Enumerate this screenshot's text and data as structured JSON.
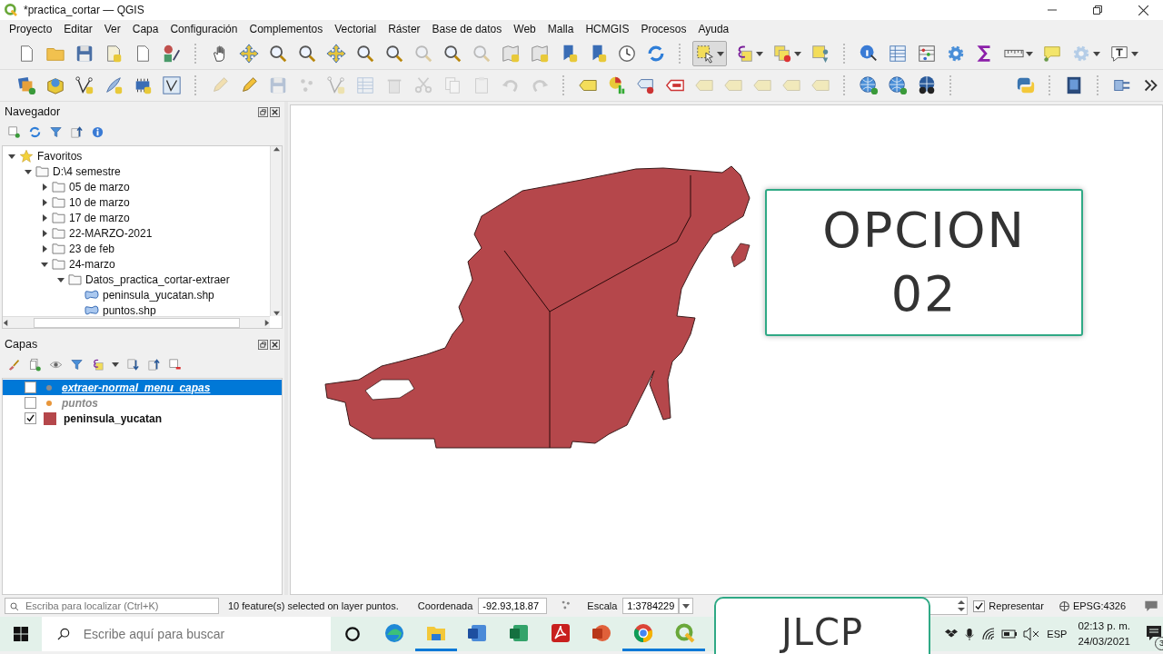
{
  "window": {
    "title": "*practica_cortar — QGIS"
  },
  "menu": [
    "Proyecto",
    "Editar",
    "Ver",
    "Capa",
    "Configuración",
    "Complementos",
    "Vectorial",
    "Ráster",
    "Base de datos",
    "Web",
    "Malla",
    "HCMGIS",
    "Procesos",
    "Ayuda"
  ],
  "navigator": {
    "title": "Navegador",
    "tree": [
      {
        "label": "Favoritos",
        "kind": "favorites",
        "expanded": true,
        "children": [
          {
            "label": "D:\\4 semestre",
            "kind": "folder",
            "expanded": true,
            "children": [
              {
                "label": "05 de marzo",
                "kind": "folder",
                "expanded": false
              },
              {
                "label": "10 de marzo",
                "kind": "folder",
                "expanded": false
              },
              {
                "label": "17 de marzo",
                "kind": "folder",
                "expanded": false
              },
              {
                "label": "22-MARZO-2021",
                "kind": "folder",
                "expanded": false
              },
              {
                "label": "23 de feb",
                "kind": "folder",
                "expanded": false
              },
              {
                "label": "24-marzo",
                "kind": "folder",
                "expanded": true,
                "children": [
                  {
                    "label": "Datos_practica_cortar-extraer",
                    "kind": "folder",
                    "expanded": true,
                    "children": [
                      {
                        "label": "peninsula_yucatan.shp",
                        "kind": "shapefile"
                      },
                      {
                        "label": "puntos.shp",
                        "kind": "shapefile"
                      }
                    ]
                  }
                ]
              }
            ]
          }
        ]
      }
    ]
  },
  "layers": {
    "title": "Capas",
    "items": [
      {
        "label": "extraer-normal_menu_capas",
        "kind": "point",
        "color": "#8c8c8c",
        "checked": false,
        "selected": true
      },
      {
        "label": "puntos",
        "kind": "point",
        "color": "#e8963a",
        "checked": false,
        "selected": false
      },
      {
        "label": "peninsula_yucatan",
        "kind": "polygon",
        "color": "#b5474b",
        "checked": true,
        "selected": false
      }
    ]
  },
  "map": {
    "overlay_card": [
      "OPCION",
      "02"
    ]
  },
  "status_bar": {
    "locator_placeholder": "Escriba para localizar (Ctrl+K)",
    "message": "10 feature(s) selected on layer puntos.",
    "coordinate_label": "Coordenada",
    "coordinate": "-92.93,18.87",
    "scale_label": "Escala",
    "scale": "1:3784229",
    "render_label": "Representar",
    "render_checked": true,
    "crs": "EPSG:4326"
  },
  "taskbar": {
    "search_placeholder": "Escribe aquí para buscar",
    "apps": [
      {
        "kind": "edge",
        "open": false
      },
      {
        "kind": "explorer",
        "open": true
      },
      {
        "kind": "word",
        "open": false
      },
      {
        "kind": "excel",
        "open": false
      },
      {
        "kind": "acrobat",
        "open": false
      },
      {
        "kind": "powerpoint",
        "open": false
      },
      {
        "kind": "chrome",
        "open": true
      },
      {
        "kind": "qgis",
        "open": true
      }
    ],
    "language": "ESP",
    "time": "02:13 p. m.",
    "date": "24/03/2021",
    "notifications": "3"
  },
  "overlay_label": "JLCP"
}
